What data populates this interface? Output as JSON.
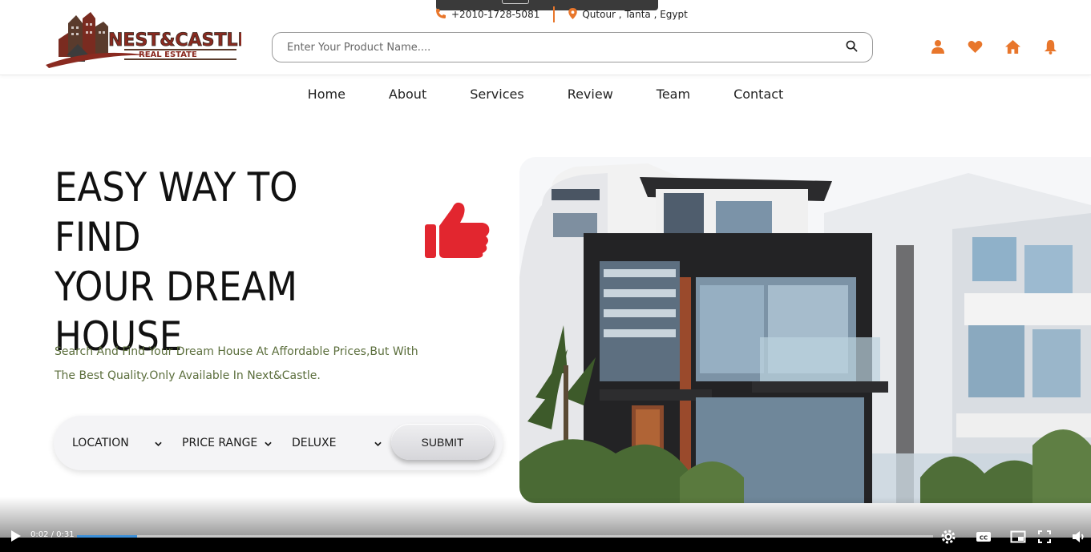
{
  "header": {
    "phone": "+2010-1728-5081",
    "address": "Qutour , Tanta , Egypt",
    "logo_text_top": "NEST&CASTLE",
    "logo_text_bottom": "REAL ESTATE",
    "search_placeholder": "Enter Your Product Name....",
    "icons": [
      "user-icon",
      "heart-icon",
      "home-icon",
      "bell-icon"
    ]
  },
  "nav": {
    "items": [
      "Home",
      "About",
      "Services",
      "Review",
      "Team",
      "Contact"
    ]
  },
  "hero": {
    "title_line1": "EASY WAY TO FIND",
    "title_line2": "YOUR DREAM",
    "title_line3": "HOUSE",
    "description": "Search And Find Your Dream House At Affordable Prices,But With The Best Quality.Only Available In Next&Castle."
  },
  "filters": {
    "location": "LOCATION",
    "price_range": "PRICE RANGE",
    "deluxe": "DELUXE",
    "submit": "SUBMIT"
  },
  "player": {
    "time": "0:02 / 0:31",
    "progress": 0.07
  },
  "colors": {
    "accent": "#e8762b",
    "thumb_red": "#e2262f",
    "desc_text": "#5b6e3c",
    "progress": "#3b8fd9"
  }
}
